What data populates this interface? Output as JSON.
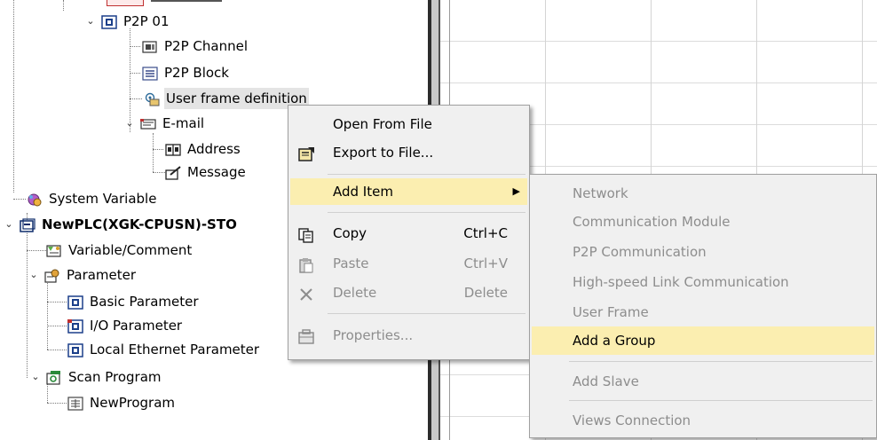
{
  "tree": {
    "items": [
      {
        "label": "P2P 01",
        "icon": "p2p-icon",
        "expander": "expanded"
      },
      {
        "label": "P2P Channel",
        "icon": "channel-icon"
      },
      {
        "label": "P2P Block",
        "icon": "block-icon"
      },
      {
        "label": "User frame definition",
        "icon": "user-frame-icon",
        "selected": true
      },
      {
        "label": "E-mail",
        "icon": "email-icon",
        "expander": "expanded"
      },
      {
        "label": "Address",
        "icon": "address-book-icon"
      },
      {
        "label": "Message",
        "icon": "message-icon"
      },
      {
        "label": "System Variable",
        "icon": "system-variable-icon"
      },
      {
        "label": "NewPLC(XGK-CPUSN)-STO",
        "icon": "plc-icon",
        "bold": true,
        "expander": "expanded"
      },
      {
        "label": "Variable/Comment",
        "icon": "variable-comment-icon"
      },
      {
        "label": "Parameter",
        "icon": "parameter-icon",
        "expander": "expanded"
      },
      {
        "label": "Basic Parameter",
        "icon": "basic-parameter-icon"
      },
      {
        "label": "I/O Parameter",
        "icon": "io-parameter-icon"
      },
      {
        "label": "Local Ethernet Parameter",
        "icon": "ethernet-parameter-icon"
      },
      {
        "label": "Scan Program",
        "icon": "scan-program-icon",
        "expander": "expanded"
      },
      {
        "label": "NewProgram",
        "icon": "program-icon"
      }
    ]
  },
  "context_menu": {
    "items": [
      {
        "label": "Open From File",
        "shortcut": "",
        "enabled": true
      },
      {
        "label": "Export to File...",
        "shortcut": "",
        "enabled": true,
        "icon": "export-icon"
      },
      {
        "label": "Add Item",
        "shortcut": "",
        "enabled": true,
        "submenu": true,
        "highlighted": true
      },
      {
        "label": "Copy",
        "shortcut": "Ctrl+C",
        "enabled": true,
        "icon": "copy-icon"
      },
      {
        "label": "Paste",
        "shortcut": "Ctrl+V",
        "enabled": false,
        "icon": "paste-icon"
      },
      {
        "label": "Delete",
        "shortcut": "Delete",
        "enabled": false,
        "icon": "delete-icon"
      },
      {
        "label": "Properties...",
        "shortcut": "",
        "enabled": false,
        "icon": "properties-icon"
      }
    ],
    "submenu_arrow": "▶"
  },
  "submenu": {
    "items": [
      {
        "label": "Network",
        "enabled": false
      },
      {
        "label": "Communication Module",
        "enabled": false
      },
      {
        "label": "P2P Communication",
        "enabled": false
      },
      {
        "label": "High-speed Link Communication",
        "enabled": false
      },
      {
        "label": "User Frame",
        "enabled": false
      },
      {
        "label": "Add a Group",
        "enabled": true,
        "highlighted": true
      },
      {
        "label": "Add Slave",
        "enabled": false
      },
      {
        "label": "Views Connection",
        "enabled": false
      }
    ]
  },
  "colors": {
    "menu_bg": "#f0f0f0",
    "highlight": "#fbeeb0",
    "disabled_text": "#8d8d8d",
    "selection": "#e4e4e4"
  }
}
